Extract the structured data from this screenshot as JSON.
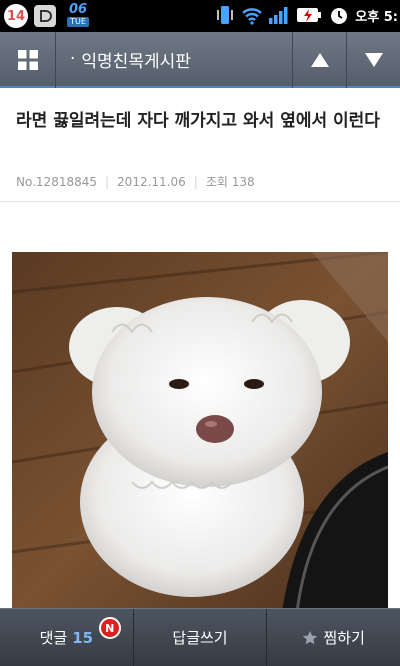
{
  "status_bar": {
    "notification_count": "14",
    "calendar_date": "06",
    "calendar_day": "TUE",
    "clock": "오후 5:"
  },
  "header": {
    "title_bullet": "·",
    "title": "익명친목게시판"
  },
  "post": {
    "title": "라면 끓일려는데 자다 깨가지고 와서 옆에서 이런다",
    "number": "No.12818845",
    "date": "2012.11.06",
    "views_label": "조회",
    "views": "138"
  },
  "bottom_bar": {
    "comment_label": "댓글",
    "comment_count": "15",
    "new_badge": "N",
    "reply_label": "답글쓰기",
    "favorite_label": "찜하기"
  },
  "colors": {
    "header_bg": "#5f6975",
    "accent_blue": "#4a87c7",
    "badge_red": "#e02020",
    "comment_count": "#7fb6f0"
  }
}
